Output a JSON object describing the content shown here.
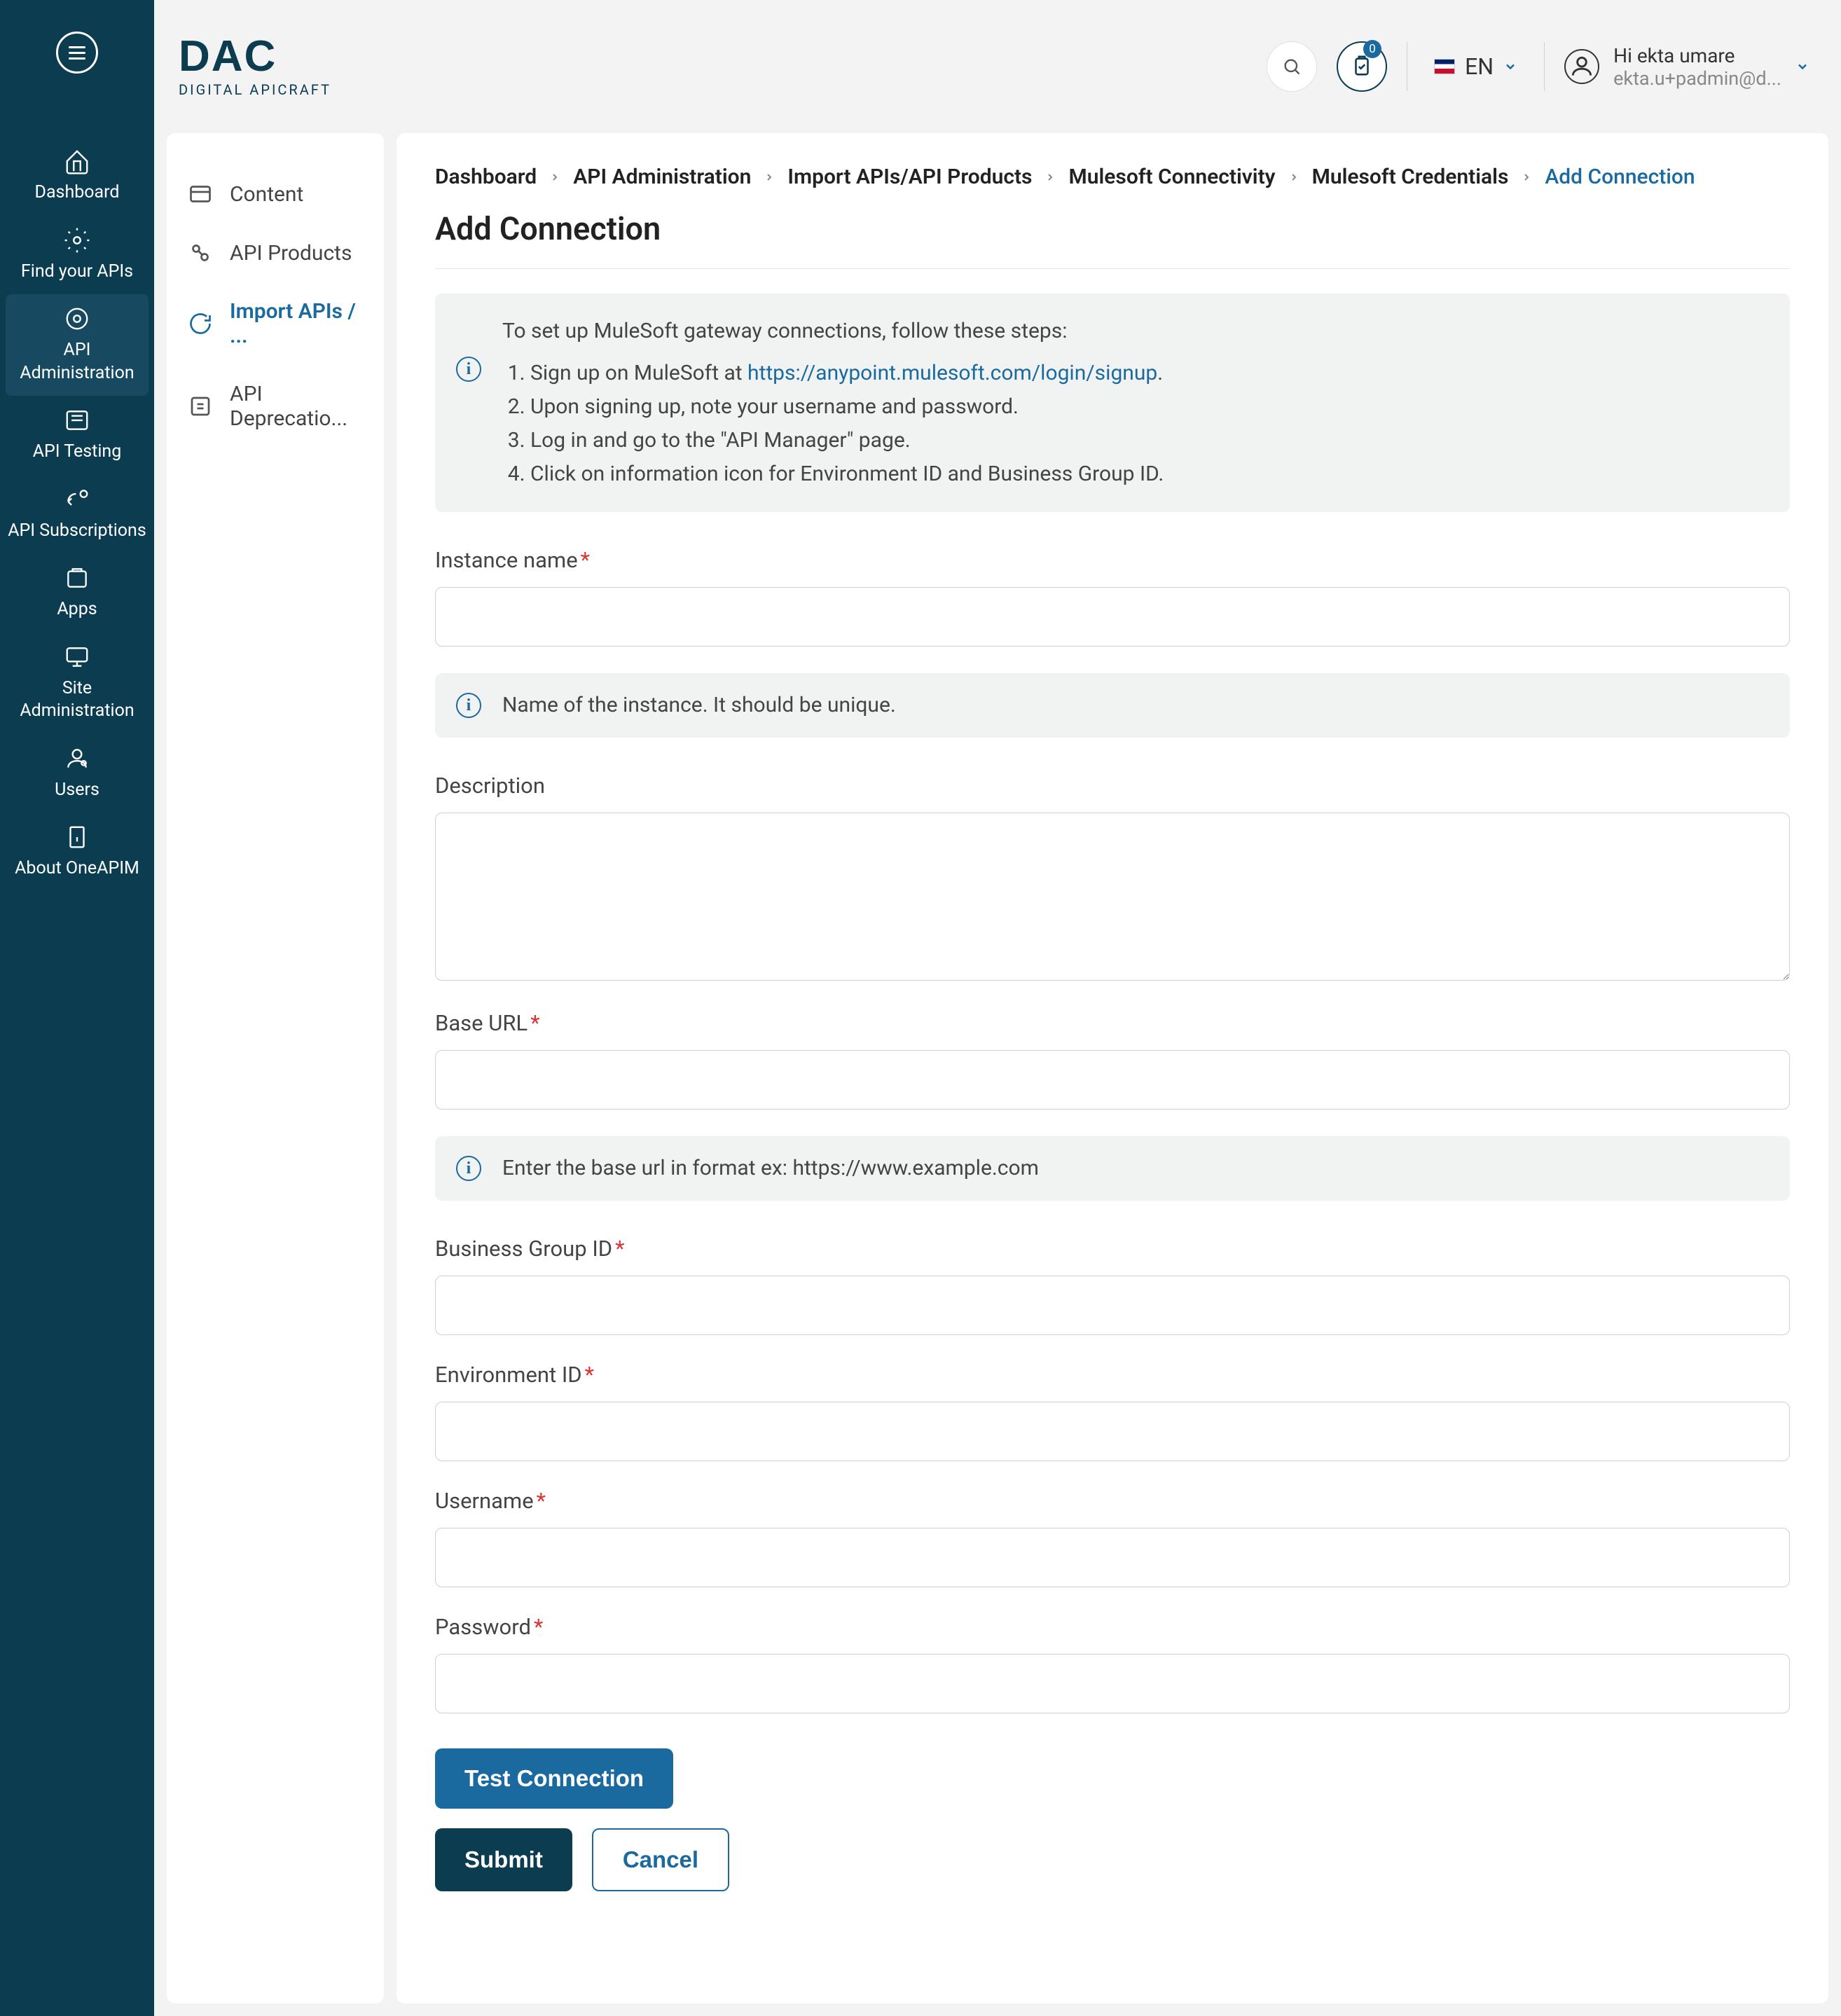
{
  "brand": {
    "name": "DAC",
    "tagline": "DIGITAL APICRAFT"
  },
  "topbar": {
    "notification_count": "0",
    "lang": "EN",
    "user_greeting": "Hi ekta umare",
    "user_email": "ekta.u+padmin@d..."
  },
  "mainnav": {
    "dashboard": "Dashboard",
    "find_apis": "Find your APIs",
    "api_admin": "API Administration",
    "api_testing": "API Testing",
    "api_subs": "API Subscriptions",
    "apps": "Apps",
    "site_admin": "Site Administration",
    "users": "Users",
    "about": "About OneAPIM"
  },
  "subnav": {
    "content": "Content",
    "api_products": "API Products",
    "import_apis": "Import APIs / ...",
    "api_deprecation": "API Deprecatio..."
  },
  "breadcrumb": {
    "items": [
      "Dashboard",
      "API Administration",
      "Import APIs/API Products",
      "Mulesoft Connectivity",
      "Mulesoft Credentials",
      "Add Connection"
    ]
  },
  "page": {
    "title": "Add Connection",
    "instructions_intro": "To set up MuleSoft gateway connections, follow these steps:",
    "instructions_step1_prefix": "Sign up on MuleSoft at ",
    "instructions_step1_link": "https://anypoint.mulesoft.com/login/signup",
    "instructions_step1_suffix": ".",
    "instructions_step2": "Upon signing up, note your username and password.",
    "instructions_step3": "Log in and go to the \"API Manager\" page.",
    "instructions_step4": "Click on information icon for Environment ID and Business Group ID.",
    "fields": {
      "instance_name_label": "Instance name",
      "instance_name_hint": "Name of the instance. It should be unique.",
      "description_label": "Description",
      "base_url_label": "Base URL",
      "base_url_hint": "Enter the base url in format ex: https://www.example.com",
      "business_group_label": "Business Group ID",
      "environment_id_label": "Environment ID",
      "username_label": "Username",
      "password_label": "Password"
    },
    "buttons": {
      "test_connection": "Test Connection",
      "submit": "Submit",
      "cancel": "Cancel"
    }
  }
}
